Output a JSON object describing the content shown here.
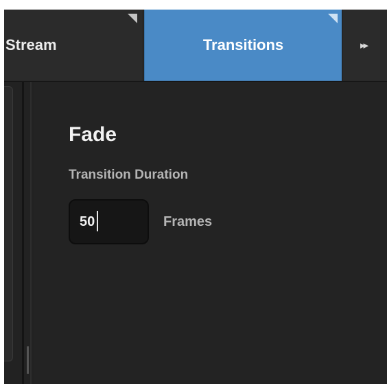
{
  "tabs": [
    {
      "label": "Stream",
      "active": false
    },
    {
      "label": "Transitions",
      "active": true
    }
  ],
  "tab_more": {
    "icon": "fast-forward-icon",
    "glyph": "▸▸"
  },
  "panel": {
    "title": "Fade",
    "field_label": "Transition Duration",
    "duration_value": "50",
    "unit_label": "Frames"
  },
  "colors": {
    "active_tab": "#4a8ac6",
    "background": "#222222",
    "tab_background": "#2b2b2b",
    "text": "#ececec"
  }
}
